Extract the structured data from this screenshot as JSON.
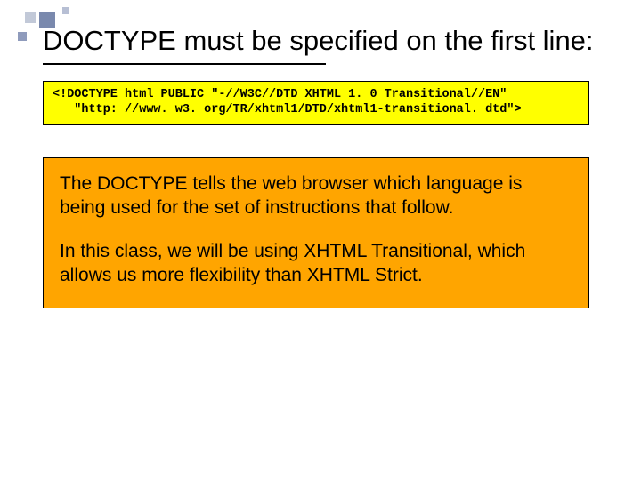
{
  "title": "DOCTYPE must be specified on the first line:",
  "code": {
    "line1": "<!DOCTYPE html PUBLIC \"-//W3C//DTD XHTML 1. 0 Transitional//EN\"",
    "line2": "   \"http: //www. w3. org/TR/xhtml1/DTD/xhtml1-transitional. dtd\">"
  },
  "body": {
    "p1": "The DOCTYPE tells the web browser which language is being used for the set of instructions that follow.",
    "p2": "In this class, we will be using XHTML Transitional, which allows us more flexibility than XHTML Strict."
  },
  "colors": {
    "code_bg": "#ffff00",
    "text_bg": "#ffa500",
    "border": "#000000"
  }
}
